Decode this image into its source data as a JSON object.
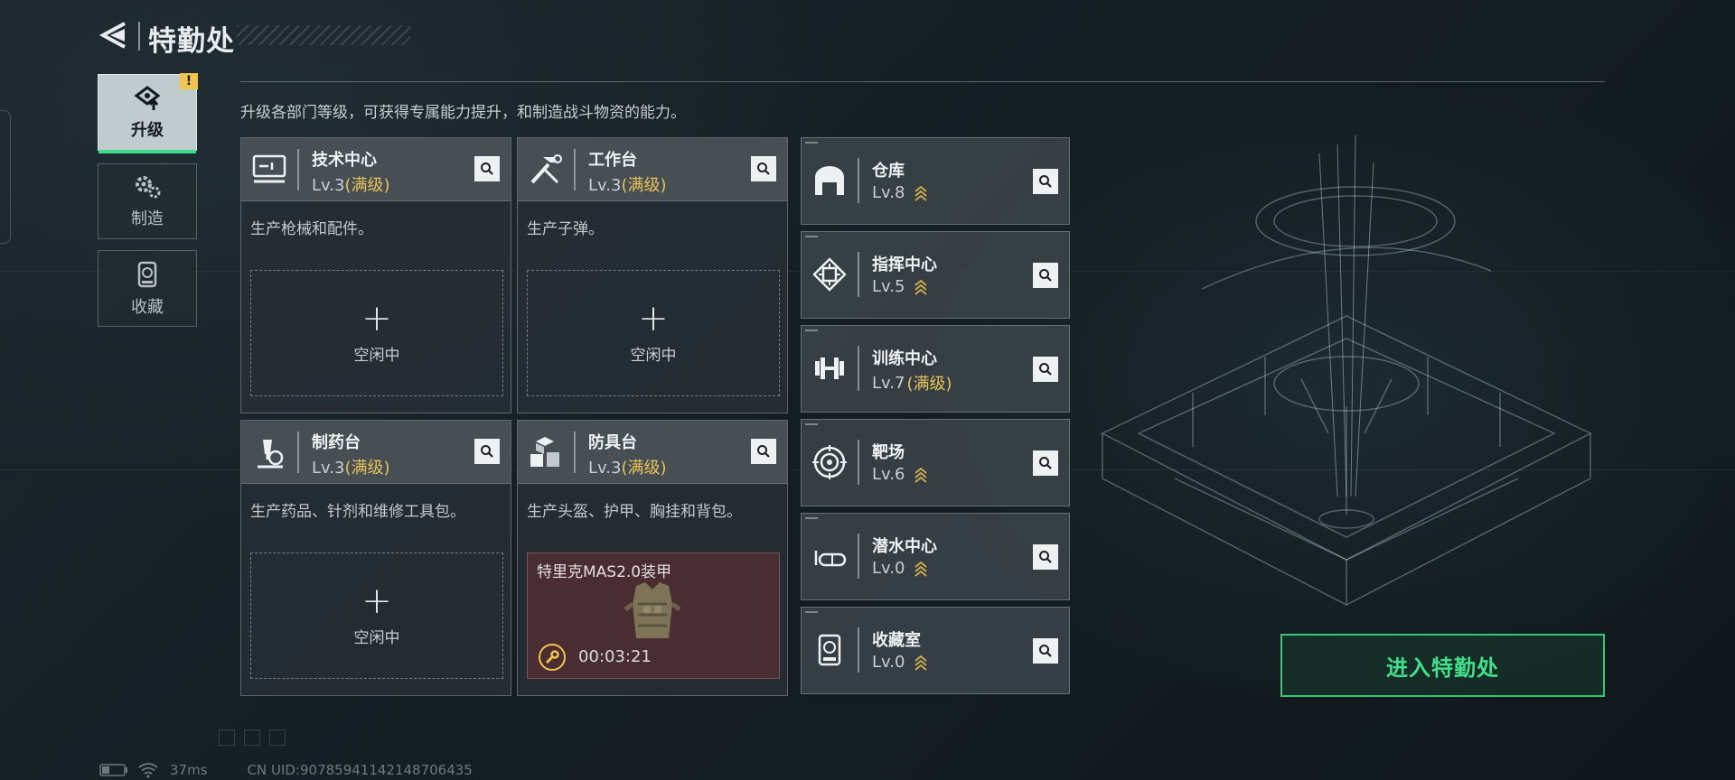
{
  "header": {
    "title": "特勤处"
  },
  "tabs": [
    {
      "label": "升级",
      "icon": "upgrade-icon",
      "active": true,
      "alert": "!"
    },
    {
      "label": "制造",
      "icon": "gears-icon",
      "active": false
    },
    {
      "label": "收藏",
      "icon": "collection-icon",
      "active": false
    }
  ],
  "description": "升级各部门等级，可获得专属能力提升，和制造战斗物资的能力。",
  "cards": [
    {
      "name": "技术中心",
      "level": "Lv.3",
      "maxed": "(满级)",
      "desc": "生产枪械和配件。",
      "icon": "monitor-icon",
      "status": "空闲中"
    },
    {
      "name": "工作台",
      "level": "Lv.3",
      "maxed": "(满级)",
      "desc": "生产子弹。",
      "icon": "tools-icon",
      "status": "空闲中"
    },
    {
      "name": "制药台",
      "level": "Lv.3",
      "maxed": "(满级)",
      "desc": "生产药品、针剂和维修工具包。",
      "icon": "microscope-icon",
      "status": "空闲中"
    },
    {
      "name": "防具台",
      "level": "Lv.3",
      "maxed": "(满级)",
      "desc": "生产头盔、护甲、胸挂和背包。",
      "icon": "boxes-icon",
      "crafting": {
        "item": "特里克MAS2.0装甲",
        "time": "00:03:21",
        "icon": "wrench-icon"
      }
    }
  ],
  "rows": [
    {
      "name": "仓库",
      "level": "Lv.8",
      "maxed": "",
      "icon": "warehouse-icon"
    },
    {
      "name": "指挥中心",
      "level": "Lv.5",
      "maxed": "",
      "icon": "command-icon"
    },
    {
      "name": "训练中心",
      "level": "Lv.7",
      "maxed": "(满级)",
      "icon": "dumbbell-icon"
    },
    {
      "name": "靶场",
      "level": "Lv.6",
      "maxed": "",
      "icon": "target-icon"
    },
    {
      "name": "潜水中心",
      "level": "Lv.0",
      "maxed": "",
      "icon": "dive-mask-icon"
    },
    {
      "name": "收藏室",
      "level": "Lv.0",
      "maxed": "",
      "icon": "collection-room-icon"
    }
  ],
  "enter_button": "进入特勤处",
  "footer": {
    "ping": "37ms",
    "uid": "CN UID:9078594114214870643​5"
  },
  "colors": {
    "accent_green": "#3fdc8c",
    "maxed_gold": "#e8c357",
    "alert_yellow": "#f1c44d"
  }
}
